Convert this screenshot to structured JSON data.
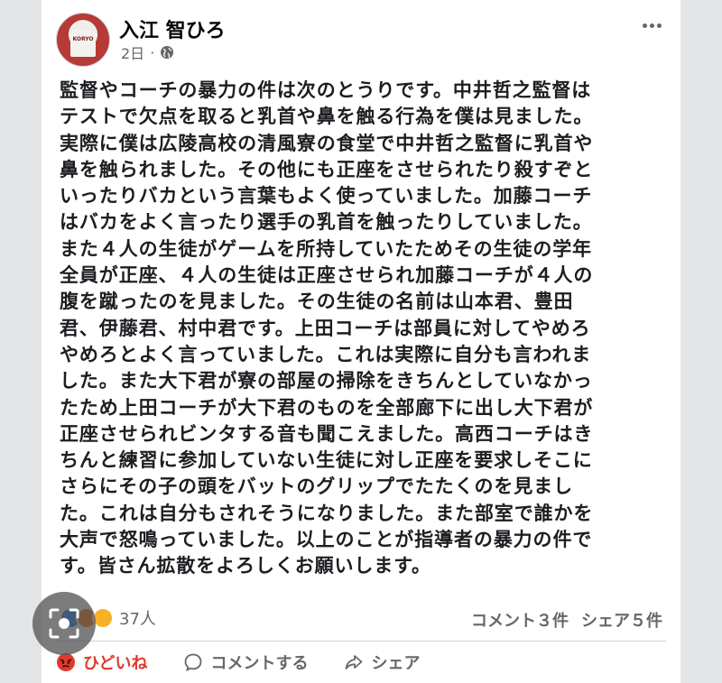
{
  "post": {
    "author": "入江 智ひろ",
    "timestamp": "2日",
    "separator": "·",
    "avatar_jersey_text": "KORYO",
    "text": "監督やコーチの暴力の件は次のとうりです。中井哲之監督は\nテストで欠点を取ると乳首や鼻を触る行為を僕は見ました。\n実際に僕は広陵高校の清風寮の食堂で中井哲之監督に乳首や\n鼻を触られました。その他にも正座をさせられたり殺すぞと\nいったりバカという言葉もよく使っていました。加藤コーチ\nはバカをよく言ったり選手の乳首を触ったりしていました。\nまた４人の生徒がゲームを所持していたためその生徒の学年\n全員が正座、４人の生徒は正座させられ加藤コーチが４人の\n腹を蹴ったのを見ました。その生徒の名前は山本君、豊田\n君、伊藤君、村中君です。上田コーチは部員に対してやめろ\nやめろとよく言っていました。これは実際に自分も言われま\nした。また大下君が寮の部屋の掃除をきちんとしていなかっ\nたため上田コーチが大下君のものを全部廊下に出し大下君が\n正座させられビンタする音も聞こえました。高西コーチはき\nちんと練習に参加していない生徒に対し正座を要求しそこに\nさらにその子の頭をバットのグリップでたたくのを見まし\nた。これは自分もされそうになりました。また部室で誰かを\n大声で怒鳴っていました。以上のことが指導者の暴力の件で\nす。皆さん拡散をよろしくお願いします。"
  },
  "engagement": {
    "reaction_count": "37人",
    "comment_count": "コメント３件",
    "share_count": "シェア５件"
  },
  "actions": {
    "angry_label": "ひどいね",
    "comment_label": "コメントする",
    "share_label": "シェア"
  },
  "colors": {
    "angry": "#e0392c",
    "secondary_text": "#65676b",
    "background": "#ffffff"
  }
}
